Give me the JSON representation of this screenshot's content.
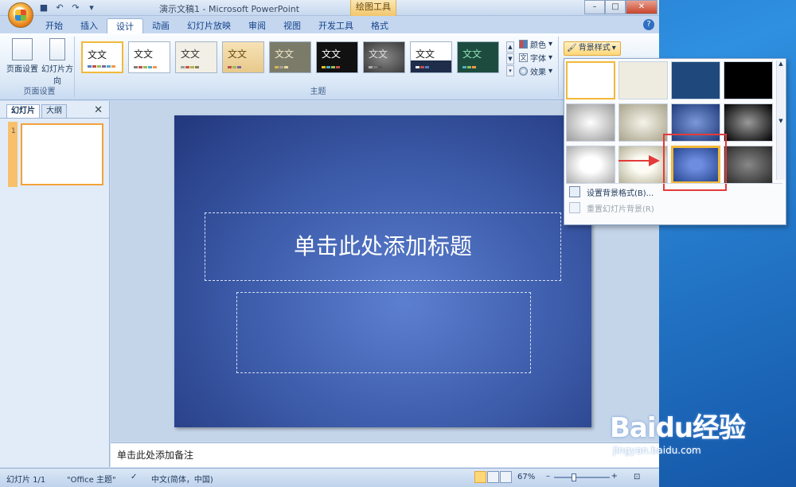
{
  "window": {
    "title": "演示文稿1 - Microsoft PowerPoint",
    "context_tab": "绘图工具"
  },
  "qat": {
    "save_icon": "save-icon",
    "undo_icon": "undo-icon",
    "redo_icon": "redo-icon"
  },
  "tabs": [
    {
      "label": "开始"
    },
    {
      "label": "插入"
    },
    {
      "label": "设计"
    },
    {
      "label": "动画"
    },
    {
      "label": "幻灯片放映"
    },
    {
      "label": "审阅"
    },
    {
      "label": "视图"
    },
    {
      "label": "开发工具"
    },
    {
      "label": "格式"
    }
  ],
  "ribbon": {
    "page_setup": {
      "page_setup_label": "页面设置",
      "orientation_label": "幻灯片方向",
      "group_label": "页面设置"
    },
    "themes": {
      "group_label": "主题",
      "sample_text": "文文",
      "colors_label": "颜色",
      "fonts_label": "字体",
      "effects_label": "效果"
    },
    "background": {
      "styles_label": "背景样式"
    }
  },
  "left_pane": {
    "tab_slides": "幻灯片",
    "tab_outline": "大纲",
    "slide_number": "1"
  },
  "slide": {
    "title_placeholder": "单击此处添加标题"
  },
  "notes": {
    "placeholder": "单击此处添加备注"
  },
  "status": {
    "slide_info": "幻灯片 1/1",
    "theme_name": "\"Office 主题\"",
    "language": "中文(简体，中国)",
    "zoom": "67%"
  },
  "bg_dropdown": {
    "format_background": "设置背景格式(B)...",
    "reset_background": "重置幻灯片背景(R)"
  },
  "watermark": {
    "logo": "Baidu经验",
    "url": "jingyan.baidu.com"
  },
  "colors": {
    "accent": "#f2b93a",
    "slide_bg": "#3f5fae",
    "highlight": "#e43a3a"
  }
}
